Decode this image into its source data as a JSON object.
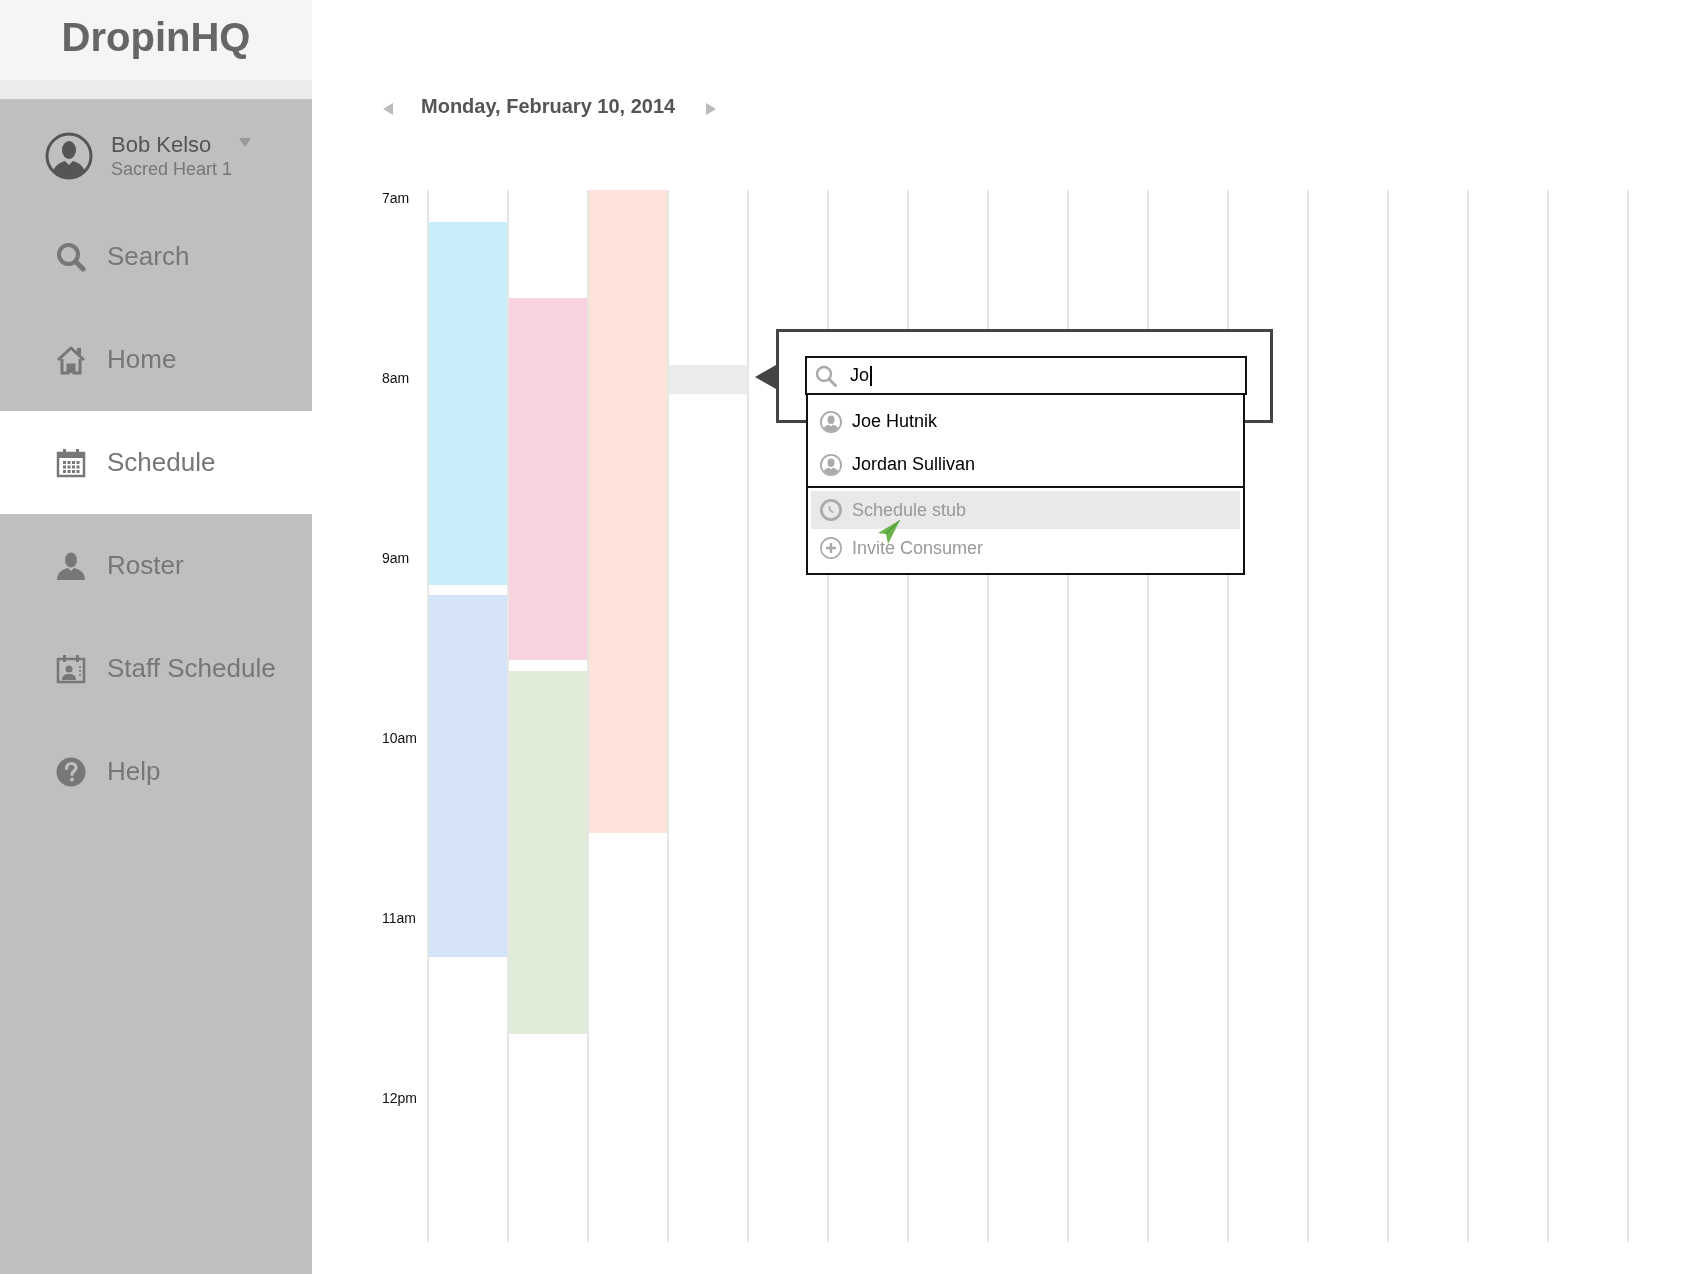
{
  "sidebar": {
    "logo": "DropinHQ",
    "user": {
      "name": "Bob Kelso",
      "location": "Sacred Heart 1"
    },
    "items": [
      {
        "label": "Search",
        "selected": false
      },
      {
        "label": "Home",
        "selected": false
      },
      {
        "label": "Schedule",
        "selected": true
      },
      {
        "label": "Roster",
        "selected": false
      },
      {
        "label": "Staff Schedule",
        "selected": false
      },
      {
        "label": "Help",
        "selected": false
      }
    ]
  },
  "date_nav": {
    "date": "Monday, February 10, 2014"
  },
  "calendar": {
    "hours": [
      "7am",
      "8am",
      "9am",
      "10am",
      "11am",
      "12pm"
    ],
    "columns": [
      {
        "events": [
          {
            "kind": "appointment",
            "color": "#c9eefb"
          },
          {
            "kind": "appointment",
            "color": "#d5e3f8"
          }
        ]
      },
      {
        "events": [
          {
            "kind": "appointment",
            "color": "#f9d2e0"
          },
          {
            "kind": "appointment",
            "color": "#e1ecd8"
          }
        ]
      },
      {
        "events": [
          {
            "kind": "appointment",
            "color": "#fde3d9"
          }
        ]
      },
      {
        "events": [
          {
            "kind": "placeholder"
          }
        ]
      }
    ]
  },
  "quick_add": {
    "search": {
      "value": "Jo"
    },
    "results": [
      {
        "kind": "person",
        "label": "Joe Hutnik",
        "selected": false
      },
      {
        "kind": "person",
        "label": "Jordan Sullivan",
        "selected": false
      },
      {
        "kind": "stub",
        "label": "Schedule stub",
        "selected": true
      },
      {
        "kind": "invite",
        "label": "Invite Consumer",
        "selected": false
      }
    ]
  }
}
